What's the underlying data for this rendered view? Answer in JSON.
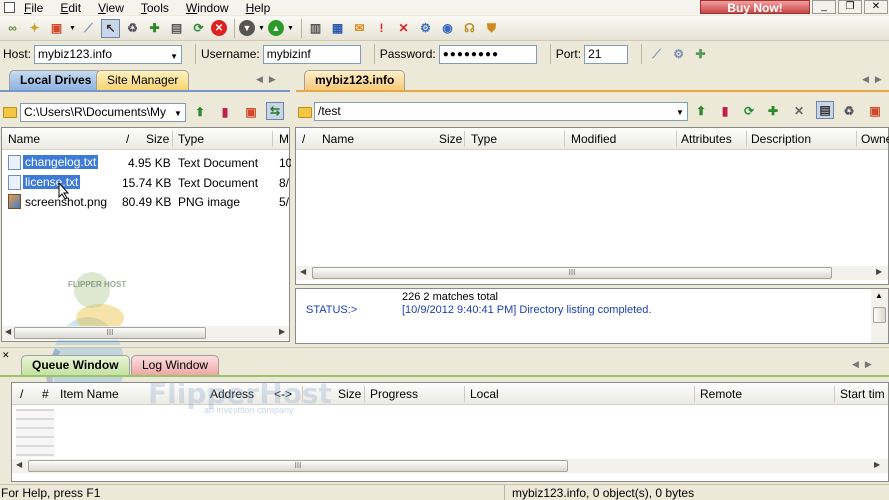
{
  "menu": {
    "items": [
      "File",
      "Edit",
      "View",
      "Tools",
      "Window",
      "Help"
    ]
  },
  "buy_now": "Buy Now!",
  "window_controls": {
    "minimize": "_",
    "maximize": "❐",
    "close": "✕"
  },
  "connection": {
    "host_label": "Host:",
    "host_value": "mybiz123.info",
    "username_label": "Username:",
    "username_value": "mybizinf",
    "password_label": "Password:",
    "password_value": "●●●●●●●●",
    "port_label": "Port:",
    "port_value": "21"
  },
  "local": {
    "tabs": [
      "Local Drives",
      "Site Manager"
    ],
    "path": "C:\\Users\\R\\Documents\\My",
    "columns": {
      "name": "Name",
      "sort": "/",
      "size": "Size",
      "type": "Type",
      "modified": "M"
    },
    "files": [
      {
        "name": "changelog.txt",
        "size": "4.95 KB",
        "type": "Text Document",
        "modified": "10",
        "selected": true
      },
      {
        "name": "license.txt",
        "size": "15.74 KB",
        "type": "Text Document",
        "modified": "8/",
        "selected": true
      },
      {
        "name": "screenshot.png",
        "size": "80.49 KB",
        "type": "PNG image",
        "modified": "5/",
        "selected": false
      }
    ]
  },
  "remote": {
    "tab": "mybiz123.info",
    "path": "/test",
    "columns": {
      "sort": "/",
      "name": "Name",
      "size": "Size",
      "type": "Type",
      "modified": "Modified",
      "attributes": "Attributes",
      "description": "Description",
      "owner": "Owne"
    }
  },
  "status_log": {
    "line1": "226 2 matches total",
    "label": "STATUS:>",
    "line2": "[10/9/2012 9:40:41 PM] Directory listing completed."
  },
  "queue": {
    "tabs": [
      "Queue Window",
      "Log Window"
    ],
    "columns": {
      "sort": "/",
      "num": "#",
      "item": "Item Name",
      "address": "Address",
      "dir": "<->",
      "size": "Size",
      "progress": "Progress",
      "local": "Local",
      "remote": "Remote",
      "start": "Start tim"
    }
  },
  "watermark": {
    "brand": "FlipperHost",
    "tagline": "an investtion company",
    "badge": "FLIPPER HOST"
  },
  "statusbar": {
    "help": "For Help, press F1",
    "summary": "mybiz123.info, 0 object(s), 0 bytes"
  },
  "scroll_grip": "III",
  "arrows": {
    "left": "◀",
    "right": "▶",
    "up": "▲",
    "down": "▼",
    "dropdown": "▼"
  },
  "icons": [
    "connect-icon",
    "wizard-icon",
    "new-site-icon",
    "disconnect-icon",
    "cursor-icon",
    "recycle-icon",
    "site-icon",
    "copy-icon",
    "refresh-icon",
    "stop-icon",
    "down-arrow-icon",
    "up-arrow-icon",
    "log-icon",
    "window-icon",
    "alert-icon",
    "exclamation-icon",
    "delete-icon",
    "settings-icon",
    "help-icon",
    "support-icon",
    "shield-icon"
  ]
}
